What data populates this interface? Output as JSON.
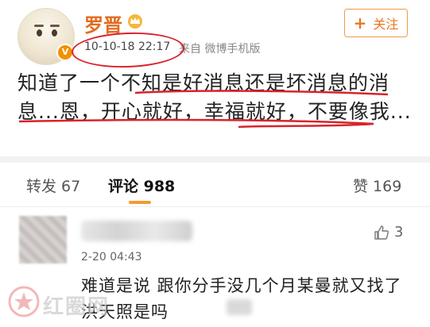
{
  "post": {
    "username": "罗晋",
    "time": "10-10-18 22:17",
    "source": "来自 微博手机版",
    "follow_label": "关注",
    "text": "知道了一个不知是好消息还是坏消息的消息...恩，开心就好，幸福就好，不要像我..."
  },
  "tabs": {
    "repost": "转发 67",
    "comment": "评论 988",
    "like": "赞 169"
  },
  "comment": {
    "time": "2-20 04:43",
    "likes": "3",
    "text": "难道是说 跟你分手没几个月某曼就又找了洪天照是吗"
  },
  "watermark": {
    "text": "红圈网"
  },
  "colors": {
    "username": "#e26c20",
    "accent": "#f39b32",
    "annotation": "#d9232b"
  },
  "icons": {
    "verified": "verified-badge-icon",
    "crown": "crown-icon",
    "thumb": "thumb-up-icon",
    "plus": "plus-icon"
  }
}
